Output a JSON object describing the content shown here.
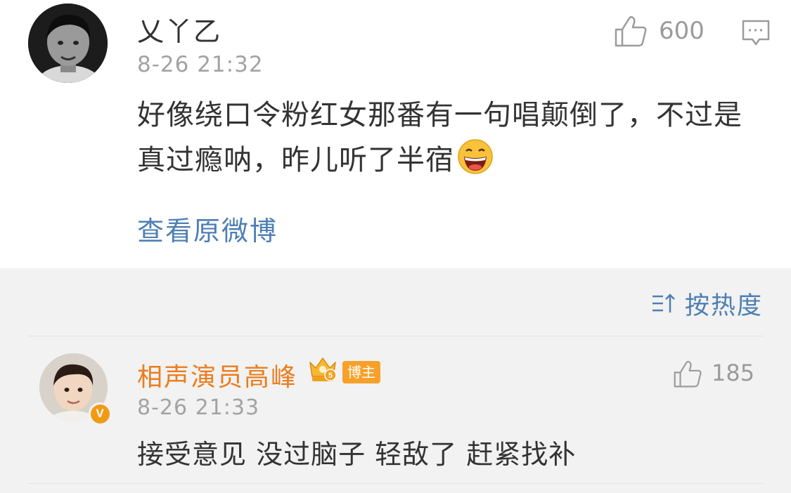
{
  "top_comment": {
    "username": "乂丫乙",
    "time": "8-26 21:32",
    "like_count": "600",
    "content": "好像绕口令粉红女那番有一句唱颠倒了，不过是真过瘾呐，昨儿听了半宿",
    "emoji_icon": "grinning-face-icon",
    "view_original_link": "查看原微博"
  },
  "sort": {
    "label": "按热度",
    "icon": "sort-icon"
  },
  "reply_comment": {
    "username": "相声演员高峰",
    "badge": "博主",
    "time": "8-26 21:33",
    "like_count": "185",
    "content": "接受意见 没过脑子 轻敌了 赶紧找补",
    "verified_mark": "V"
  },
  "colors": {
    "link_blue": "#4e7fb3",
    "author_orange": "#eb7d1e",
    "badge_orange": "#f7a12a",
    "muted_gray": "#a3a3a3",
    "section_bg": "#f2f2f2"
  }
}
